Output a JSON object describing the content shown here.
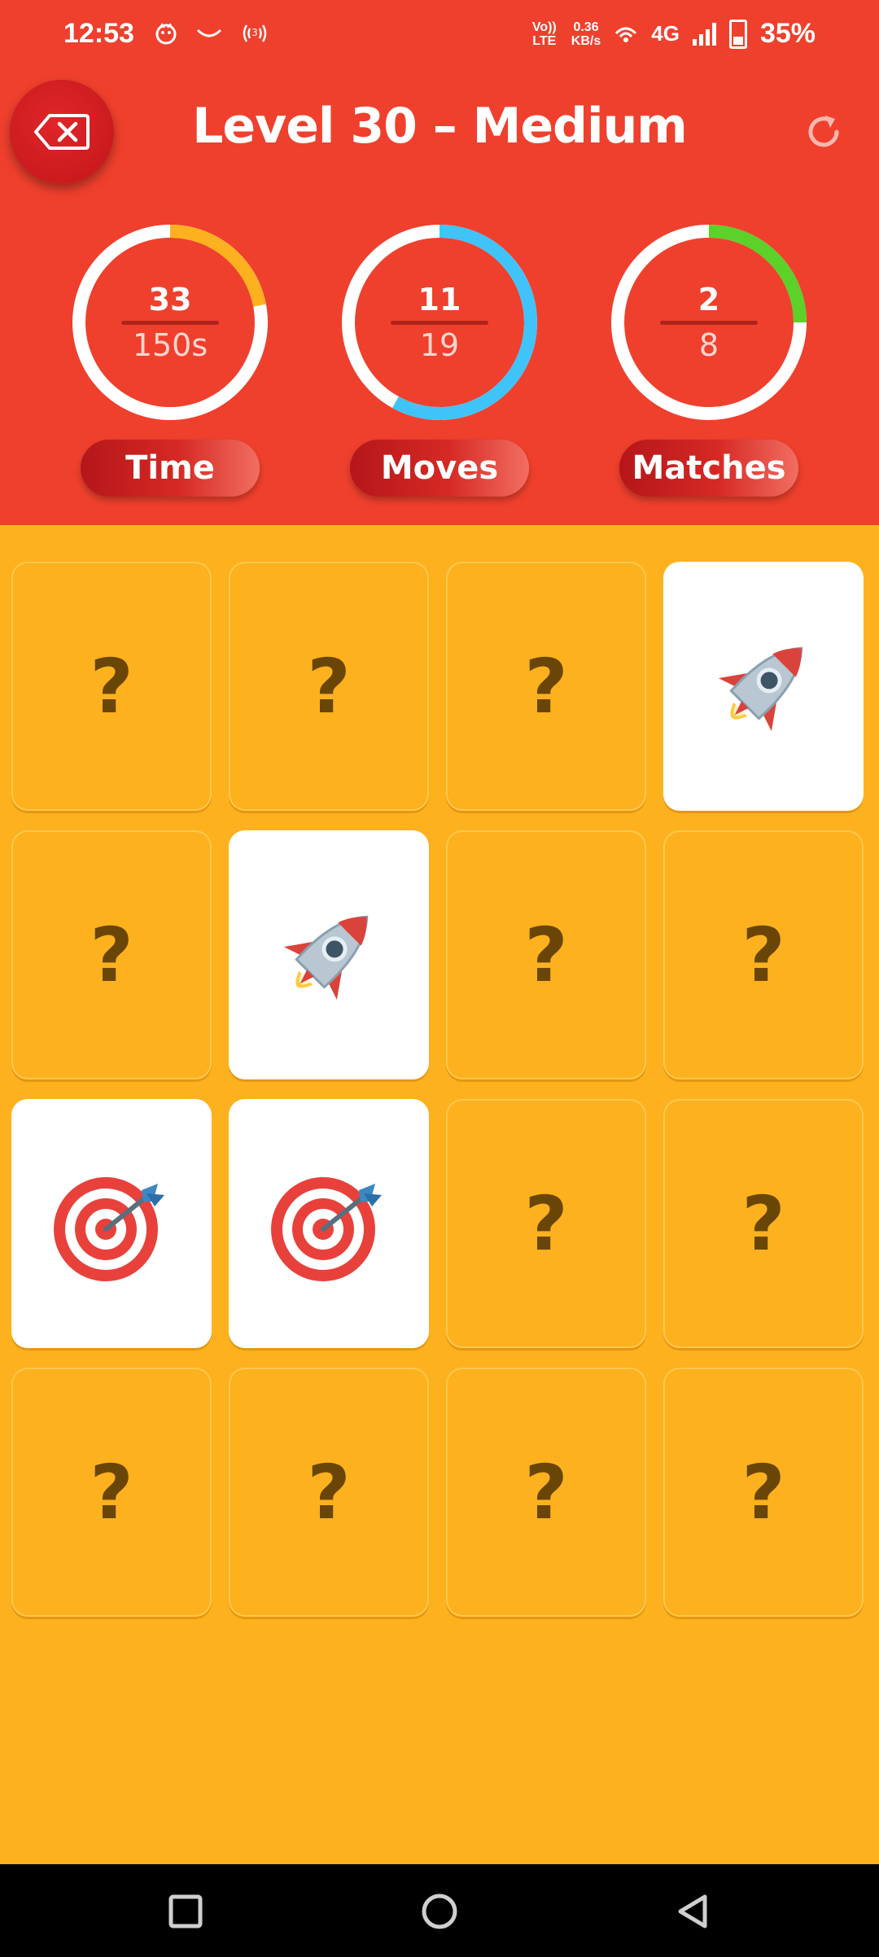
{
  "status": {
    "time": "12:53",
    "left_icons": [
      "notification-icon",
      "smile-icon",
      "hotspot-icon"
    ],
    "volte": "Vo)) LTE",
    "speed_value": "0.36",
    "speed_unit": "KB/s",
    "network": "4G",
    "battery": "35%"
  },
  "header": {
    "title": "Level 30 – Medium",
    "back_icon": "backspace-icon",
    "refresh_icon": "refresh-icon"
  },
  "stats": [
    {
      "label": "Time",
      "value": "33",
      "total": "150s",
      "progress": 0.22,
      "color": "#FEB11E"
    },
    {
      "label": "Moves",
      "value": "11",
      "total": "19",
      "progress": 0.58,
      "color": "#3FC3F9"
    },
    {
      "label": "Matches",
      "value": "2",
      "total": "8",
      "progress": 0.25,
      "color": "#5BD129"
    }
  ],
  "board": {
    "rows": 4,
    "cols": 4,
    "hidden_symbol": "?",
    "cards": [
      {
        "state": "hidden"
      },
      {
        "state": "hidden"
      },
      {
        "state": "hidden"
      },
      {
        "state": "revealed",
        "icon": "rocket-icon"
      },
      {
        "state": "hidden"
      },
      {
        "state": "revealed",
        "icon": "rocket-icon"
      },
      {
        "state": "hidden"
      },
      {
        "state": "hidden"
      },
      {
        "state": "revealed",
        "icon": "target-icon"
      },
      {
        "state": "revealed",
        "icon": "target-icon"
      },
      {
        "state": "hidden"
      },
      {
        "state": "hidden"
      },
      {
        "state": "hidden"
      },
      {
        "state": "hidden"
      },
      {
        "state": "hidden"
      },
      {
        "state": "hidden"
      }
    ]
  },
  "navbar": {
    "icons": [
      "recents-icon",
      "home-icon",
      "back-icon"
    ]
  }
}
